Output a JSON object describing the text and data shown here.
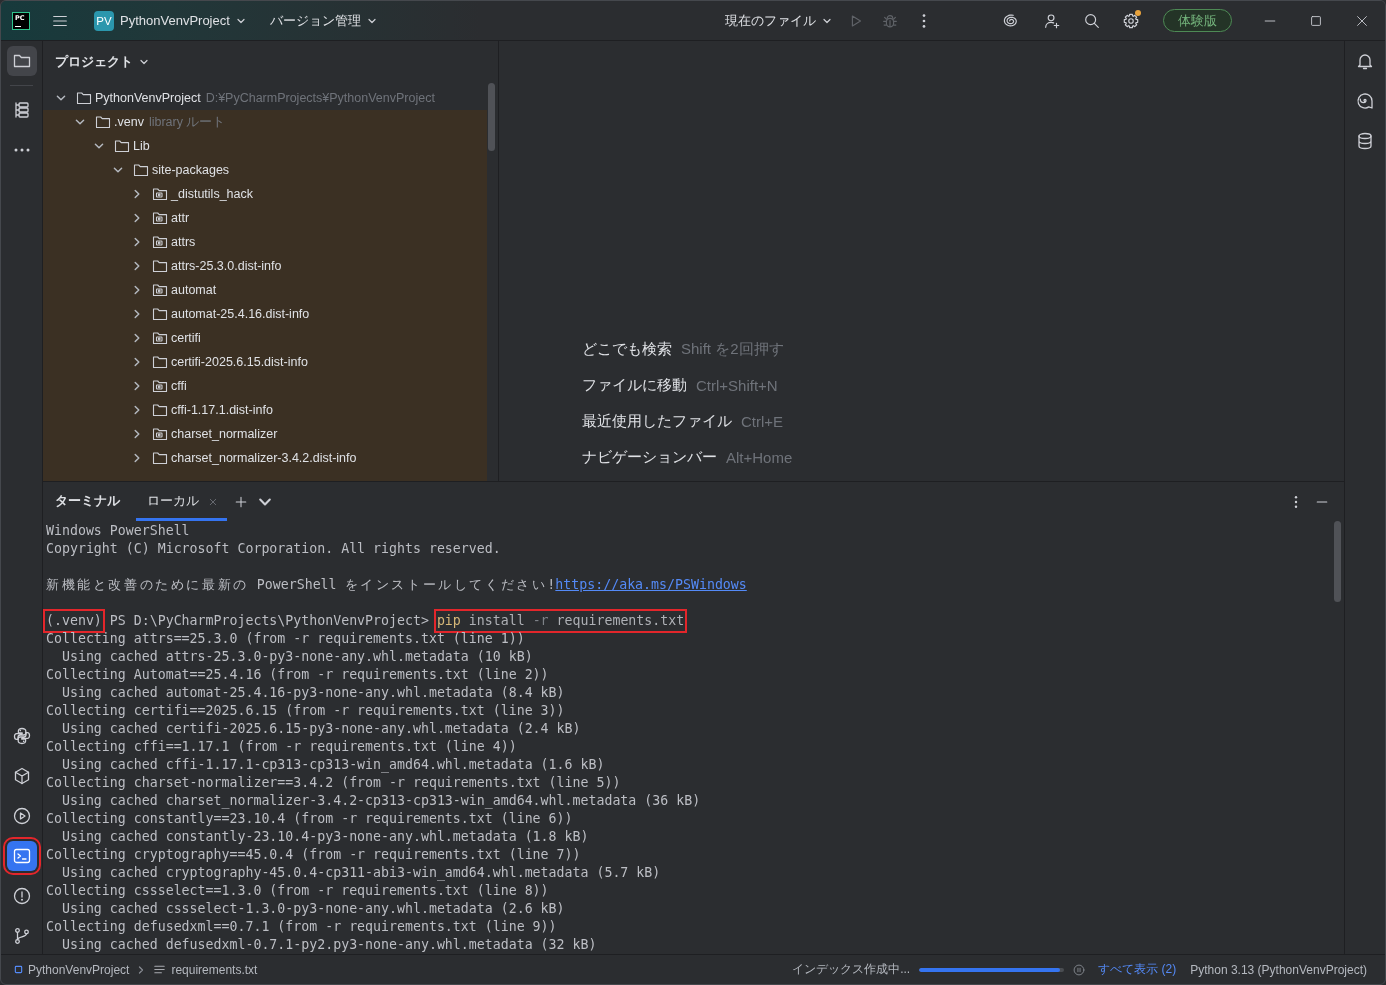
{
  "title_bar": {
    "logo": "PC",
    "project": {
      "badge": "PV",
      "name": "PythonVenvProject"
    },
    "vcs_menu": "バージョン管理",
    "run_configuration": "現在のファイル",
    "run_actions": [
      {
        "kind": "run",
        "disabled": true
      },
      {
        "kind": "debug",
        "disabled": true
      }
    ],
    "settings_notification": true,
    "trial_badge": "体験版"
  },
  "left_tool_strip": {
    "top": [
      {
        "kind": "project",
        "selected": true,
        "focused": false,
        "highlighted": false
      },
      {
        "kind": "structure",
        "selected": false,
        "focused": false,
        "highlighted": false
      },
      {
        "kind": "more",
        "selected": false,
        "focused": false,
        "highlighted": false
      }
    ],
    "bottom": [
      {
        "kind": "python_console",
        "selected": false,
        "focused": false,
        "highlighted": false
      },
      {
        "kind": "packages",
        "selected": false,
        "focused": false,
        "highlighted": false
      },
      {
        "kind": "services",
        "selected": false,
        "focused": false,
        "highlighted": false
      },
      {
        "kind": "terminal",
        "selected": true,
        "focused": true,
        "highlighted": true
      },
      {
        "kind": "problems",
        "selected": false,
        "focused": false,
        "highlighted": false
      },
      {
        "kind": "git",
        "selected": false,
        "focused": false,
        "highlighted": false
      }
    ]
  },
  "project_panel": {
    "title": "プロジェクト",
    "tree": [
      {
        "kind": "folder",
        "name": "PythonVenvProject",
        "hint": "D:¥PyCharmProjects¥PythonVenvProject",
        "expanded": true,
        "children": [
          {
            "kind": "folder",
            "name": ".venv",
            "hint": "library ルート",
            "library_root": true,
            "expanded": true,
            "children": [
              {
                "kind": "folder",
                "name": "Lib",
                "expanded": true,
                "children": [
                  {
                    "kind": "folder",
                    "name": "site-packages",
                    "expanded": true,
                    "children": [
                      {
                        "kind": "package",
                        "name": "_distutils_hack",
                        "expanded": false
                      },
                      {
                        "kind": "package",
                        "name": "attr",
                        "expanded": false
                      },
                      {
                        "kind": "package",
                        "name": "attrs",
                        "expanded": false
                      },
                      {
                        "kind": "folder",
                        "name": "attrs-25.3.0.dist-info",
                        "expanded": false
                      },
                      {
                        "kind": "package",
                        "name": "automat",
                        "expanded": false
                      },
                      {
                        "kind": "folder",
                        "name": "automat-25.4.16.dist-info",
                        "expanded": false
                      },
                      {
                        "kind": "package",
                        "name": "certifi",
                        "expanded": false
                      },
                      {
                        "kind": "folder",
                        "name": "certifi-2025.6.15.dist-info",
                        "expanded": false
                      },
                      {
                        "kind": "package",
                        "name": "cffi",
                        "expanded": false
                      },
                      {
                        "kind": "folder",
                        "name": "cffi-1.17.1.dist-info",
                        "expanded": false
                      },
                      {
                        "kind": "package",
                        "name": "charset_normalizer",
                        "expanded": false
                      },
                      {
                        "kind": "folder",
                        "name": "charset_normalizer-3.4.2.dist-info",
                        "expanded": false
                      }
                    ]
                  }
                ]
              }
            ]
          }
        ]
      }
    ]
  },
  "editor_hints": [
    {
      "action": "どこでも検索",
      "shortcut": "Shift を2回押す"
    },
    {
      "action": "ファイルに移動",
      "shortcut": "Ctrl+Shift+N"
    },
    {
      "action": "最近使用したファイル",
      "shortcut": "Ctrl+E"
    },
    {
      "action": "ナビゲーションバー",
      "shortcut": "Alt+Home"
    }
  ],
  "right_tool_strip": [
    {
      "kind": "notifications"
    },
    {
      "kind": "ai_chat"
    },
    {
      "kind": "database"
    }
  ],
  "terminal": {
    "title": "ターミナル",
    "tabs": [
      {
        "label": "ローカル",
        "selected": true
      }
    ],
    "lines": [
      {
        "kind": "output",
        "text": "Windows PowerShell"
      },
      {
        "kind": "output",
        "text": "Copyright (C) Microsoft Corporation. All rights reserved."
      },
      {
        "kind": "blank"
      },
      {
        "kind": "notice",
        "text": "新機能と改善のために最新の PowerShell をインストールしてください!",
        "link": "https://aka.ms/PSWindows"
      },
      {
        "kind": "blank"
      },
      {
        "kind": "prompt",
        "env": "(.venv)",
        "env_highlighted": true,
        "path": "PS D:\\PyCharmProjects\\PythonVenvProject>",
        "command": [
          {
            "kind": "program",
            "text": "pip"
          },
          {
            "kind": "argument",
            "text": "install"
          },
          {
            "kind": "option",
            "text": "-r"
          },
          {
            "kind": "argument",
            "text": "requirements.txt"
          }
        ],
        "command_highlighted": true
      },
      {
        "kind": "output",
        "text": "Collecting attrs==25.3.0 (from -r requirements.txt (line 1))"
      },
      {
        "kind": "output",
        "text": "  Using cached attrs-25.3.0-py3-none-any.whl.metadata (10 kB)"
      },
      {
        "kind": "output",
        "text": "Collecting Automat==25.4.16 (from -r requirements.txt (line 2))"
      },
      {
        "kind": "output",
        "text": "  Using cached automat-25.4.16-py3-none-any.whl.metadata (8.4 kB)"
      },
      {
        "kind": "output",
        "text": "Collecting certifi==2025.6.15 (from -r requirements.txt (line 3))"
      },
      {
        "kind": "output",
        "text": "  Using cached certifi-2025.6.15-py3-none-any.whl.metadata (2.4 kB)"
      },
      {
        "kind": "output",
        "text": "Collecting cffi==1.17.1 (from -r requirements.txt (line 4))"
      },
      {
        "kind": "output",
        "text": "  Using cached cffi-1.17.1-cp313-cp313-win_amd64.whl.metadata (1.6 kB)"
      },
      {
        "kind": "output",
        "text": "Collecting charset-normalizer==3.4.2 (from -r requirements.txt (line 5))"
      },
      {
        "kind": "output",
        "text": "  Using cached charset_normalizer-3.4.2-cp313-cp313-win_amd64.whl.metadata (36 kB)"
      },
      {
        "kind": "output",
        "text": "Collecting constantly==23.10.4 (from -r requirements.txt (line 6))"
      },
      {
        "kind": "output",
        "text": "  Using cached constantly-23.10.4-py3-none-any.whl.metadata (1.8 kB)"
      },
      {
        "kind": "output",
        "text": "Collecting cryptography==45.0.4 (from -r requirements.txt (line 7))"
      },
      {
        "kind": "output",
        "text": "  Using cached cryptography-45.0.4-cp311-abi3-win_amd64.whl.metadata (5.7 kB)"
      },
      {
        "kind": "output",
        "text": "Collecting cssselect==1.3.0 (from -r requirements.txt (line 8))"
      },
      {
        "kind": "output",
        "text": "  Using cached cssselect-1.3.0-py3-none-any.whl.metadata (2.6 kB)"
      },
      {
        "kind": "output",
        "text": "Collecting defusedxml==0.7.1 (from -r requirements.txt (line 9))"
      },
      {
        "kind": "output",
        "text": "  Using cached defusedxml-0.7.1-py2.py3-none-any.whl.metadata (32 kB)"
      }
    ]
  },
  "status_bar": {
    "breadcrumbs": [
      {
        "kind": "project",
        "label": "PythonVenvProject"
      },
      {
        "kind": "file",
        "label": "requirements.txt"
      }
    ],
    "indexing": {
      "label": "インデックス作成中...",
      "level": 0.97
    },
    "show_all": "すべて表示 (2)",
    "interpreter": "Python 3.13 (PythonVenvProject)"
  }
}
